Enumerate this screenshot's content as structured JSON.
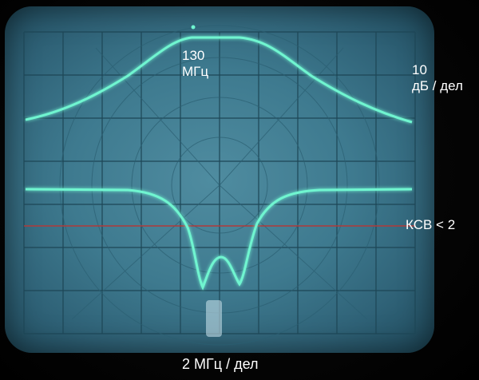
{
  "labels": {
    "center_freq_line1": "130",
    "center_freq_line2": "МГц",
    "vertical_scale_line1": "10",
    "vertical_scale_line2": "дБ / дел",
    "swr_marker": "КСВ < 2",
    "horizontal_scale": "2 МГц / дел"
  },
  "colors": {
    "trace": "#6ff5d0",
    "graticule": "#1d4656",
    "marker_line": "#b03a3a",
    "screen": "#3e7a8f"
  }
}
